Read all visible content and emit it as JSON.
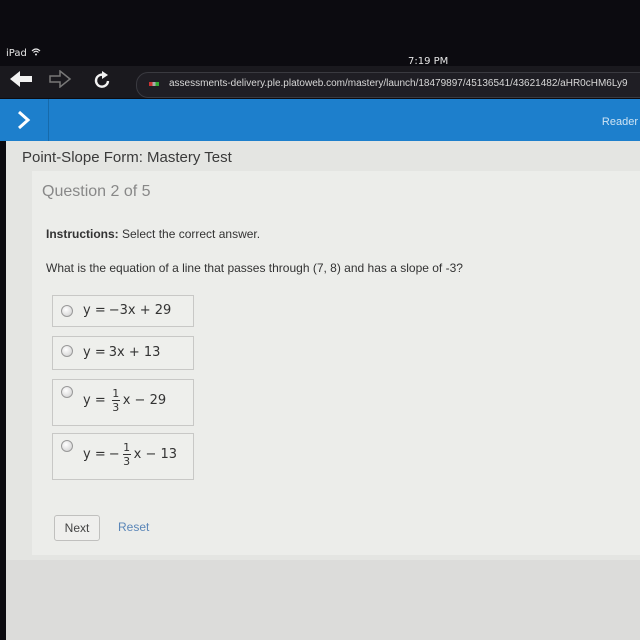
{
  "status_bar": {
    "device": "iPad",
    "wifi_icon": "wifi-icon",
    "time": "7:19 PM"
  },
  "browser": {
    "back_icon": "back-arrow-icon",
    "forward_icon": "forward-arrow-icon",
    "reload_icon": "reload-icon",
    "url": "assessments-delivery.ple.platoweb.com/mastery/launch/18479897/45136541/43621482/aHR0cHM6Ly9"
  },
  "app_bar": {
    "toggle_icon": "chevron-right-icon",
    "reader_label": "Reader"
  },
  "test": {
    "title": "Point-Slope Form: Mastery Test",
    "question_number": "Question 2 of 5",
    "instructions_label": "Instructions:",
    "instructions_text": " Select the correct answer.",
    "question_text": "What is the equation of a line that passes through (7, 8) and has a slope of -3?",
    "options": [
      {
        "lhs": "y =",
        "text": "−3x + 29",
        "selected": false
      },
      {
        "lhs": "y =",
        "text": "3x + 13",
        "selected": false
      },
      {
        "lhs": "y =",
        "sign": "",
        "num": "1",
        "den": "3",
        "rest": "x − 29",
        "selected": false
      },
      {
        "lhs": "y =",
        "sign": "−",
        "num": "1",
        "den": "3",
        "rest": "x − 13",
        "selected": false
      }
    ],
    "next_label": "Next",
    "reset_label": "Reset"
  }
}
